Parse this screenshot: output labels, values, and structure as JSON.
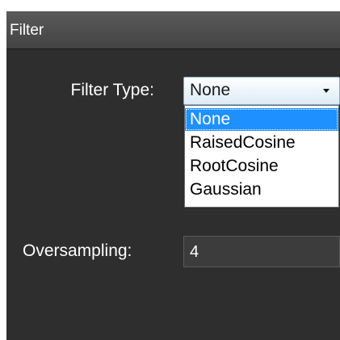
{
  "panel": {
    "title": "Filter"
  },
  "filter_type": {
    "label": "Filter Type:",
    "selected": "None",
    "options": [
      "None",
      "RaisedCosine",
      "RootCosine",
      "Gaussian"
    ],
    "highlighted_index": 0
  },
  "oversampling": {
    "label": "Oversampling:",
    "value": "4"
  },
  "icons": {
    "dropdown_arrow": "chevron-down-icon"
  },
  "colors": {
    "panel_background": "#2e2e2e",
    "header_background": "#4a4a4a",
    "selection_highlight": "#1e90ff",
    "text_light": "#ffffff"
  }
}
